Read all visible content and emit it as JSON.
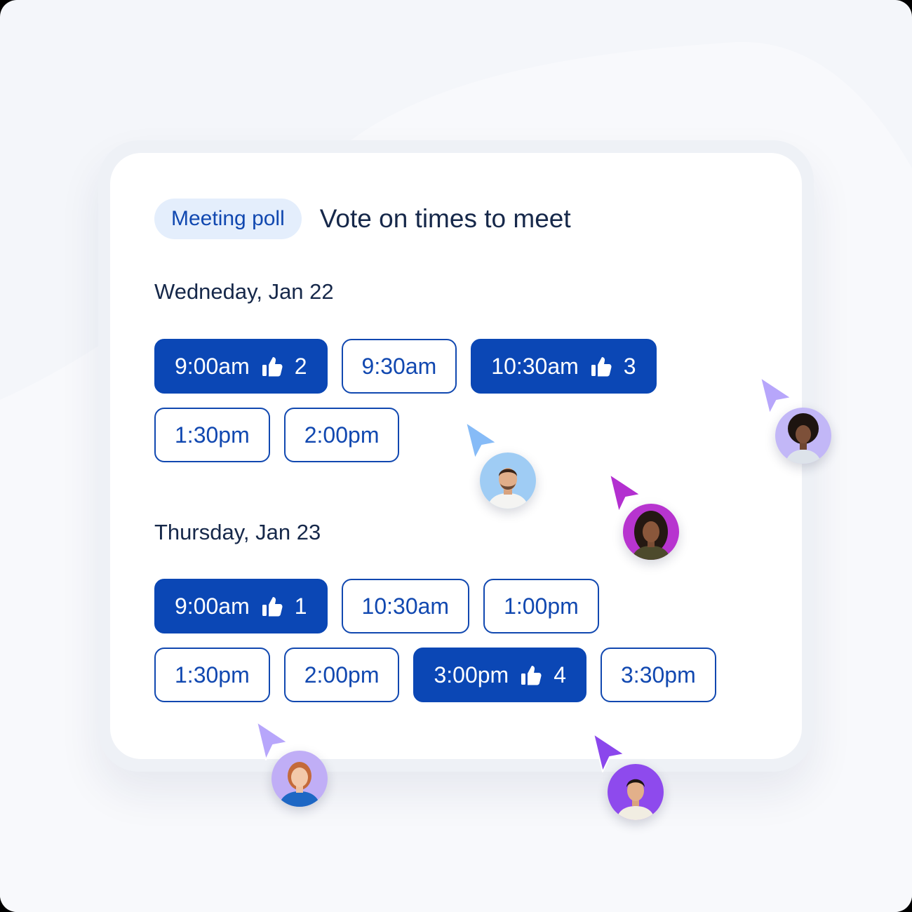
{
  "header": {
    "tag": "Meeting poll",
    "title": "Vote on times to meet"
  },
  "days": [
    {
      "label": "Wedneday, Jan 22",
      "rows": [
        [
          {
            "time": "9:00am",
            "votes": "2",
            "selected": true
          },
          {
            "time": "9:30am",
            "selected": false
          },
          {
            "time": "10:30am",
            "votes": "3",
            "selected": true
          }
        ],
        [
          {
            "time": "1:30pm",
            "selected": false
          },
          {
            "time": "2:00pm",
            "selected": false
          }
        ]
      ]
    },
    {
      "label": "Thursday, Jan 23",
      "rows": [
        [
          {
            "time": "9:00am",
            "votes": "1",
            "selected": true
          },
          {
            "time": "10:30am",
            "selected": false
          },
          {
            "time": "1:00pm",
            "selected": false
          }
        ],
        [
          {
            "time": "1:30pm",
            "selected": false
          },
          {
            "time": "2:00pm",
            "selected": false
          },
          {
            "time": "3:00pm",
            "votes": "4",
            "selected": true
          },
          {
            "time": "3:30pm",
            "selected": false
          }
        ]
      ]
    }
  ],
  "icons": {
    "vote": "thumbs-up-icon",
    "pointer": "cursor-arrow-icon"
  },
  "colors": {
    "primary": "#0b47b5",
    "tag_bg": "#e4eefc",
    "text": "#16284a",
    "cursor_blue": "#86bbf7",
    "cursor_magenta": "#b32fd0",
    "cursor_lilac": "#b7a6fb",
    "cursor_violet": "#8b47ec"
  }
}
